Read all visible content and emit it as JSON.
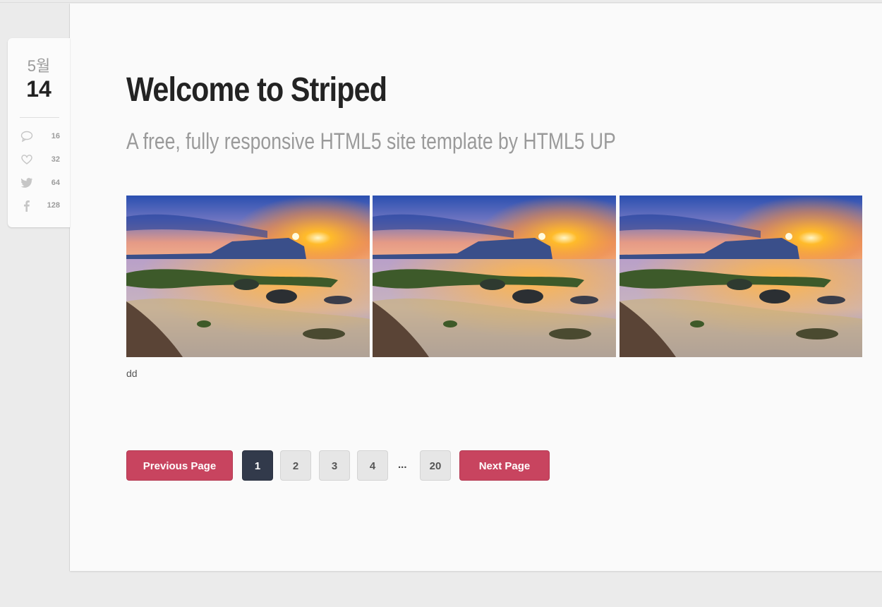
{
  "post": {
    "month": "5월",
    "day": "14",
    "stats": [
      {
        "icon": "comment-icon",
        "count": "16"
      },
      {
        "icon": "heart-icon",
        "count": "32"
      },
      {
        "icon": "twitter-icon",
        "count": "64"
      },
      {
        "icon": "facebook-icon",
        "count": "128"
      }
    ],
    "title": "Welcome to Striped",
    "subtitle": "A free, fully responsive HTML5 site template by HTML5 UP",
    "caption": "dd"
  },
  "pagination": {
    "previous_label": "Previous Page",
    "next_label": "Next Page",
    "pages": [
      "1",
      "2",
      "3",
      "4",
      "20"
    ],
    "ellipsis": "...",
    "current_page": "1"
  },
  "colors": {
    "accent": "#c8445f",
    "active_page": "#323a4b"
  }
}
